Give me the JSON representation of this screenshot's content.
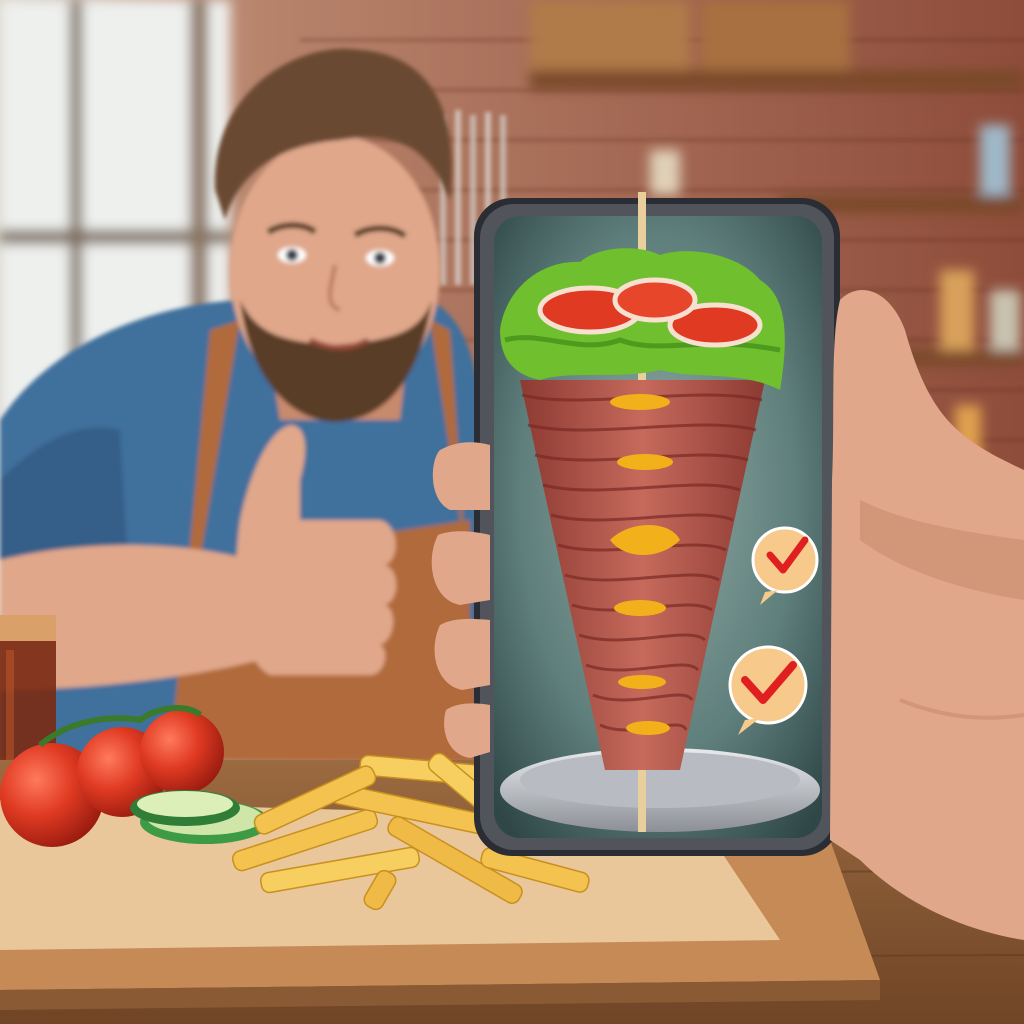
{
  "scene": {
    "kind": "photo",
    "subjects": [
      "man-giving-thumbs-up",
      "hand-holding-phone",
      "doner-kebab-on-screen",
      "tomatoes",
      "cucumber-slices",
      "french-fries",
      "glass-of-drink"
    ]
  },
  "palette": {
    "brick": "#9a4e3a",
    "brick_light": "#b86a52",
    "shirt": "#3f6f9c",
    "apron": "#b06b3b",
    "skin": "#e0a78a",
    "skin_shadow": "#c88a6d",
    "hair": "#6a4a33",
    "beard": "#5a3c28",
    "phone_frame": "#2a2d33",
    "screen_bg": "#5f7f7c",
    "screen_bg_edge": "#2f4747",
    "meat": "#b4584c",
    "meat_dark": "#8c3a32",
    "mustard": "#f2b01a",
    "lettuce": "#6fbf2e",
    "tomato": "#e03a22",
    "fries": "#f3c24f",
    "cucumber": "#3d9a45",
    "board": "#c58a55",
    "table": "#8a5a34",
    "paper": "#e9c79b",
    "check_bubble": "#f7c98a",
    "check_mark": "#e02020",
    "drink": "#7a2a12"
  }
}
